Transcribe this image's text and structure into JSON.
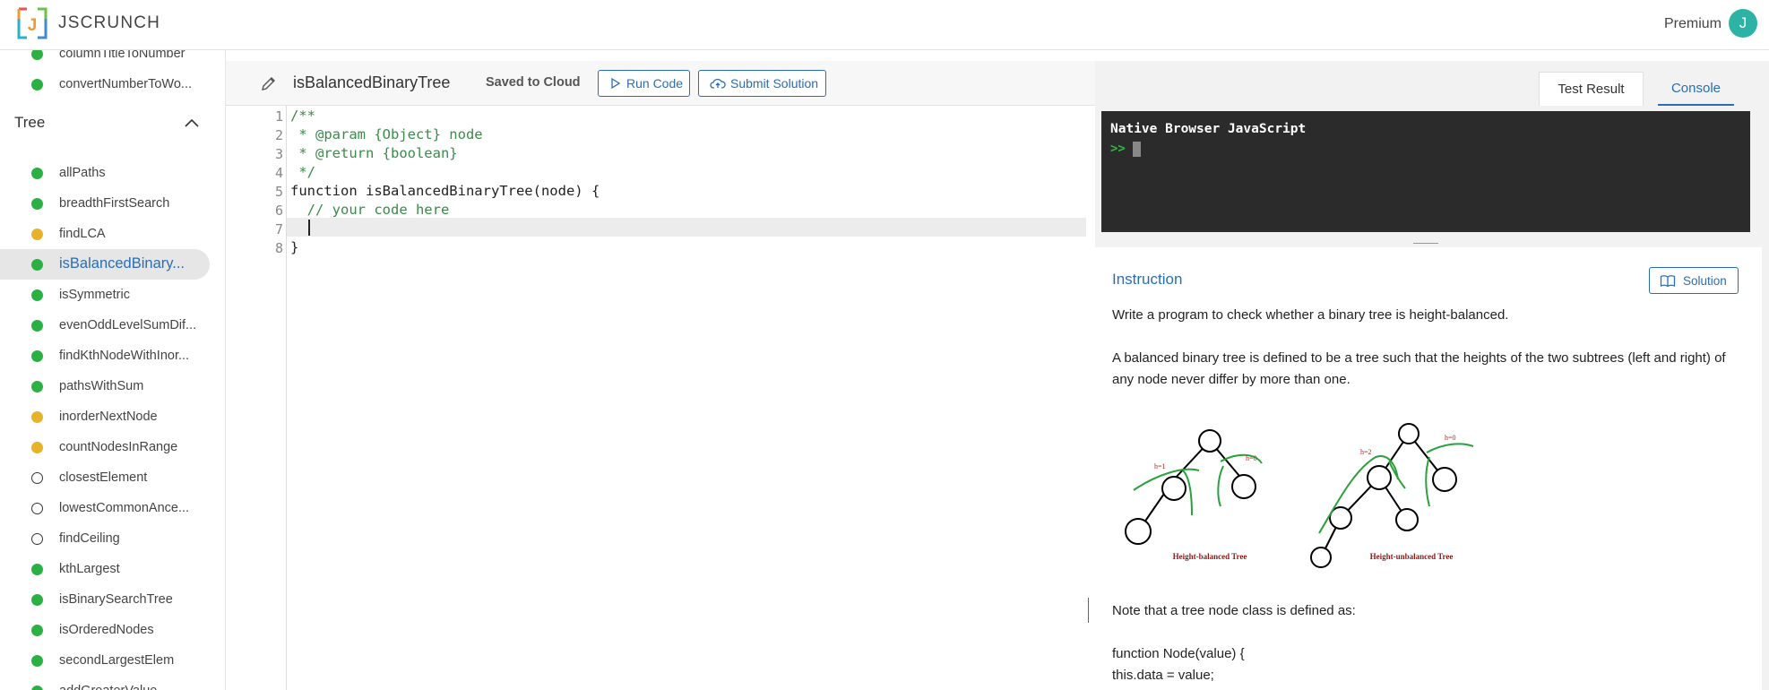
{
  "app": {
    "logo_letter": "J",
    "name": "JSCRUNCH",
    "premium_label": "Premium",
    "avatar_initial": "J"
  },
  "sidebar": {
    "prev_items": [
      {
        "label": "columnTitleToNumber",
        "status": "done"
      },
      {
        "label": "convertNumberToWo...",
        "status": "done"
      }
    ],
    "section_title": "Tree",
    "items": [
      {
        "label": "allPaths",
        "status": "done"
      },
      {
        "label": "breadthFirstSearch",
        "status": "done"
      },
      {
        "label": "findLCA",
        "status": "partial"
      },
      {
        "label": "isBalancedBinary...",
        "status": "done"
      },
      {
        "label": "isSymmetric",
        "status": "done"
      },
      {
        "label": "evenOddLevelSumDif...",
        "status": "done"
      },
      {
        "label": "findKthNodeWithInor...",
        "status": "done"
      },
      {
        "label": "pathsWithSum",
        "status": "done"
      },
      {
        "label": "inorderNextNode",
        "status": "partial"
      },
      {
        "label": "countNodesInRange",
        "status": "partial"
      },
      {
        "label": "closestElement",
        "status": "todo"
      },
      {
        "label": "lowestCommonAnce...",
        "status": "todo"
      },
      {
        "label": "findCeiling",
        "status": "todo"
      },
      {
        "label": "kthLargest",
        "status": "done"
      },
      {
        "label": "isBinarySearchTree",
        "status": "done"
      },
      {
        "label": "isOrderedNodes",
        "status": "done"
      },
      {
        "label": "secondLargestElem",
        "status": "done"
      },
      {
        "label": "addGreaterValue",
        "status": "done"
      }
    ]
  },
  "editor": {
    "file_name": "isBalancedBinaryTree",
    "save_status": "Saved to Cloud",
    "run_label": "Run Code",
    "submit_label": "Submit Solution",
    "line_numbers": [
      "1",
      "2",
      "3",
      "4",
      "5",
      "6",
      "7",
      "8"
    ],
    "code_lines": [
      "/**",
      " * @param {Object} node",
      " * @return {boolean}",
      " */",
      "function isBalancedBinaryTree(node) {",
      "  // your code here",
      "  ",
      "}"
    ]
  },
  "right_panel": {
    "tab_test_result": "Test Result",
    "tab_console": "Console",
    "console_header": "Native Browser JavaScript",
    "console_prompt": ">>",
    "instruction_title": "Instruction",
    "solution_label": "Solution",
    "paragraphs": [
      "Write a program to check whether a binary tree is height-balanced.",
      "A balanced binary tree is defined to be a tree such that the heights of the two subtrees (left and right) of any node never differ by more than one.",
      "Note that a tree node class is defined as:",
      "function Node(value) {",
      "this.data = value;"
    ],
    "figure": {
      "left_caption": "Height-balanced Tree",
      "right_caption": "Height-unbalanced Tree",
      "left_h1": "h=1",
      "left_h0": "h=0",
      "right_h2": "h=2",
      "right_h0": "h=0"
    }
  },
  "colors": {
    "accent": "#2a6db5",
    "done": "#2bb143",
    "partial": "#e5b22a",
    "comment": "#3b8a4a"
  }
}
